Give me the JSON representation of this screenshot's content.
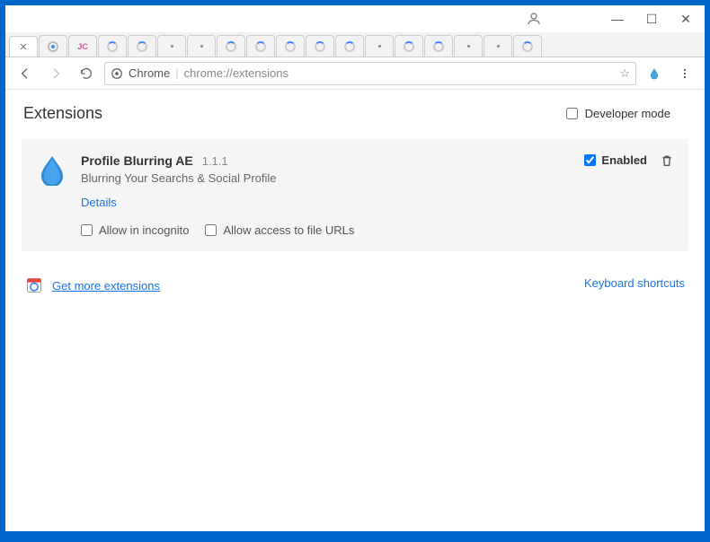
{
  "window": {
    "minimize": "—",
    "maximize": "☐",
    "close": "✕"
  },
  "tabs": {
    "active_close": "✕",
    "jc_label": "JC"
  },
  "toolbar": {
    "chrome_label": "Chrome",
    "url_path": "chrome://extensions"
  },
  "page": {
    "title": "Extensions",
    "developer_mode": "Developer mode"
  },
  "extension": {
    "name": "Profile Blurring AE",
    "version": "1.1.1",
    "description": "Blurring Your Searchs & Social Profile",
    "details": "Details",
    "allow_incognito": "Allow in incognito",
    "allow_file_urls": "Allow access to file URLs",
    "enabled_label": "Enabled",
    "enabled_checked": true
  },
  "footer": {
    "get_more": "Get more extensions",
    "keyboard_shortcuts": "Keyboard shortcuts"
  }
}
